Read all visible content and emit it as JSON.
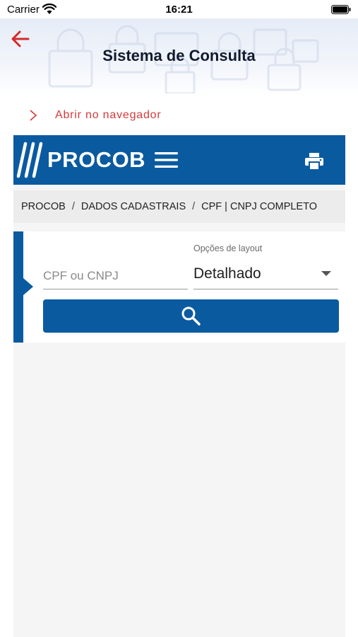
{
  "status_bar": {
    "carrier": "Carrier",
    "time": "16:21"
  },
  "header": {
    "title": "Sistema de Consulta",
    "back_icon": "arrow-left-icon"
  },
  "open_browser": {
    "label": "Abrir no navegador",
    "icon": "chevron-right-icon"
  },
  "web": {
    "logo_text": "PROCOB",
    "menu_icon": "hamburger-icon",
    "print_icon": "printer-icon",
    "breadcrumb": [
      "PROCOB",
      "DADOS CADASTRAIS",
      "CPF | CNPJ COMPLETO"
    ],
    "breadcrumb_separator": "/",
    "document_input": {
      "placeholder": "CPF ou CNPJ",
      "value": ""
    },
    "layout_select": {
      "label": "Opções de layout",
      "selected": "Detalhado"
    },
    "search_icon": "magnifier-icon"
  },
  "colors": {
    "brand_blue": "#0a5aa0",
    "accent_red": "#d43a3a",
    "title_dark": "#111a2e"
  }
}
